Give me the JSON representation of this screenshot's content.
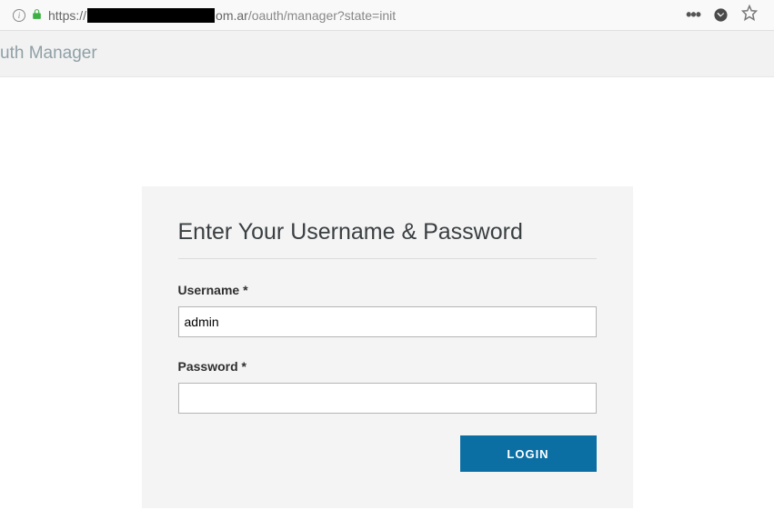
{
  "browser": {
    "url_prefix": "https://",
    "url_suffix_domain": "om.ar",
    "url_path": "/oauth/manager?state=init"
  },
  "header": {
    "title_fragment": "uth Manager"
  },
  "login": {
    "card_title": "Enter Your Username & Password",
    "username_label": "Username *",
    "username_value": "admin",
    "password_label": "Password *",
    "password_value": "",
    "button_label": "LOGIN"
  }
}
